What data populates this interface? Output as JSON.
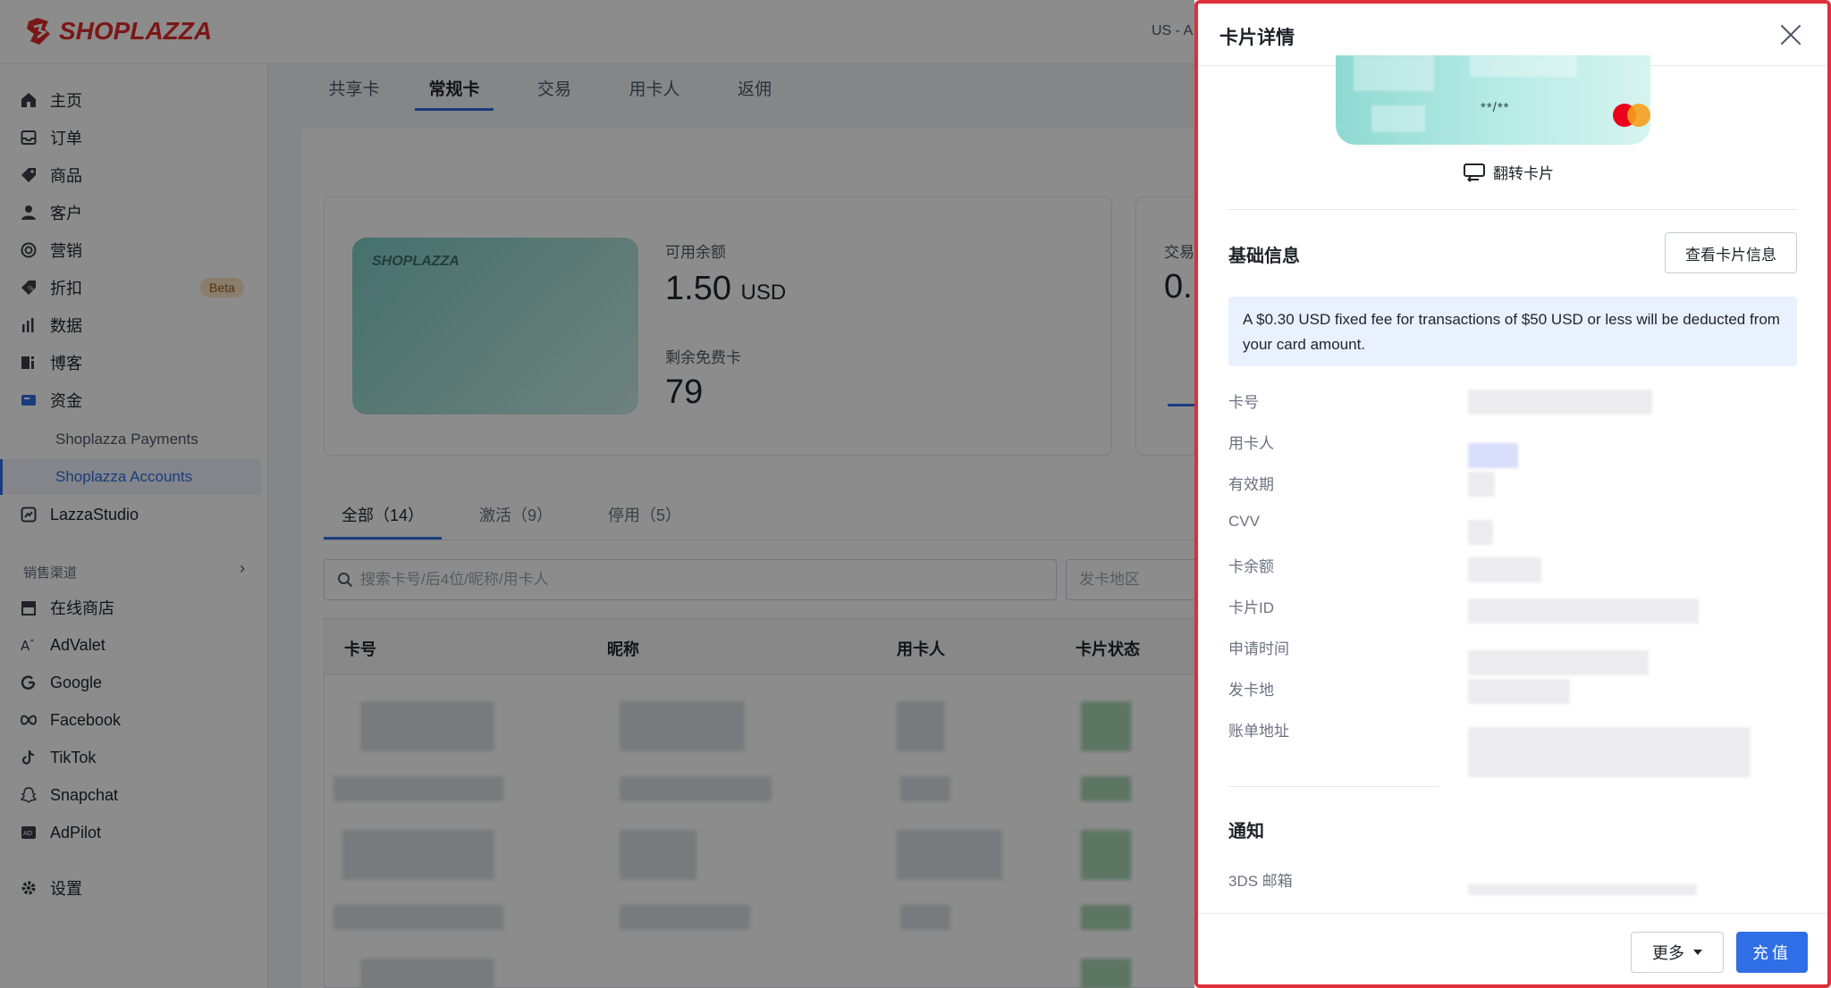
{
  "app": {
    "brand": "SHOPLAZZA",
    "region_text": "US - A",
    "brand_color": "#e02b2b",
    "accent_color": "#2f6ee5"
  },
  "sidebar": {
    "items": [
      {
        "label": "主页",
        "icon": "home-icon"
      },
      {
        "label": "订单",
        "icon": "inbox-icon"
      },
      {
        "label": "商品",
        "icon": "tag-icon"
      },
      {
        "label": "客户",
        "icon": "user-icon"
      },
      {
        "label": "营销",
        "icon": "target-icon"
      },
      {
        "label": "折扣",
        "icon": "discount-icon",
        "badge": "Beta"
      },
      {
        "label": "数据",
        "icon": "bar-chart-icon"
      },
      {
        "label": "博客",
        "icon": "blog-icon"
      },
      {
        "label": "资金",
        "icon": "wallet-icon"
      }
    ],
    "funds_sub": [
      "Shoplazza Payments",
      "Shoplazza Accounts"
    ],
    "lazza": "LazzaStudio",
    "channels_label": "销售渠道",
    "channels": [
      {
        "label": "在线商店",
        "icon": "store-icon"
      },
      {
        "label": "AdValet",
        "icon": "advalet-icon"
      },
      {
        "label": "Google",
        "icon": "google-icon"
      },
      {
        "label": "Facebook",
        "icon": "meta-icon"
      },
      {
        "label": "TikTok",
        "icon": "tiktok-icon"
      },
      {
        "label": "Snapchat",
        "icon": "snapchat-icon"
      },
      {
        "label": "AdPilot",
        "icon": "adpilot-icon"
      }
    ],
    "settings": "设置"
  },
  "main_tabs": [
    "共享卡",
    "常规卡",
    "交易",
    "用卡人",
    "返佣"
  ],
  "summary": {
    "card_logo": "SHOPLAZZA",
    "available_label": "可用余额",
    "available_value": "1.50",
    "available_unit": "USD",
    "free_label": "剩余免费卡",
    "free_value": "79",
    "trade_label": "交易",
    "trade_value": "0."
  },
  "filter_tabs": [
    "全部（14）",
    "激活（9）",
    "停用（5）"
  ],
  "search": {
    "placeholder": "搜索卡号/后4位/昵称/用卡人"
  },
  "region_select": {
    "placeholder": "发卡地区"
  },
  "table": {
    "headers": [
      "卡号",
      "昵称",
      "用卡人",
      "卡片状态"
    ]
  },
  "drawer": {
    "title": "卡片详情",
    "card_mask": "**/**",
    "flip_label": "翻转卡片",
    "basic_title": "基础信息",
    "view_card_button": "查看卡片信息",
    "notice": "A $0.30 USD fixed fee for transactions of $50 USD or less will be deducted from your card amount.",
    "fields": [
      "卡号",
      "用卡人",
      "有效期",
      "CVV",
      "卡余额",
      "卡片ID",
      "申请时间",
      "发卡地",
      "账单地址"
    ],
    "notify_title": "通知",
    "notify_fields": [
      "3DS 邮箱"
    ],
    "more_button": "更多",
    "topup_button": "充值"
  }
}
